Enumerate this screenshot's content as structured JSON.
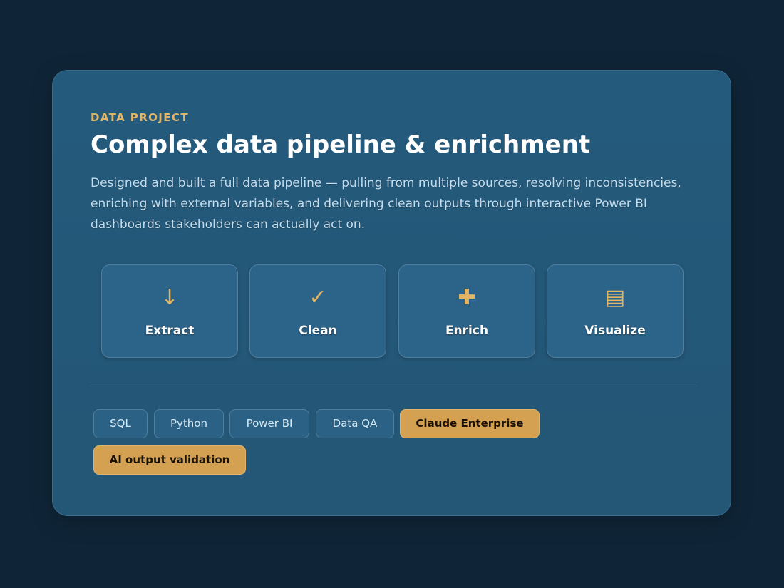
{
  "project": {
    "eyebrow": "DATA PROJECT",
    "title": "Complex data pipeline & enrichment",
    "description": "Designed and built a full data pipeline — pulling from multiple sources, resolving inconsistencies, enriching with external variables, and delivering clean outputs through interactive Power BI dashboards stakeholders can actually act on."
  },
  "steps": [
    {
      "label": "Extract",
      "icon": "↓",
      "icon_name": "arrow-down-icon"
    },
    {
      "label": "Clean",
      "icon": "✓",
      "icon_name": "checkmark-icon"
    },
    {
      "label": "Enrich",
      "icon": "✚",
      "icon_name": "plus-icon"
    },
    {
      "label": "Visualize",
      "icon": "▤",
      "icon_name": "report-icon"
    }
  ],
  "tags": [
    {
      "label": "SQL",
      "highlight": false
    },
    {
      "label": "Python",
      "highlight": false
    },
    {
      "label": "Power BI",
      "highlight": false
    },
    {
      "label": "Data QA",
      "highlight": false
    },
    {
      "label": "Claude Enterprise",
      "highlight": true
    },
    {
      "label": "AI output validation",
      "highlight": true
    }
  ],
  "colors": {
    "background": "#0f2537",
    "card": "#245a7c",
    "accent": "#e2b567",
    "tag_highlight": "#d4a152"
  }
}
